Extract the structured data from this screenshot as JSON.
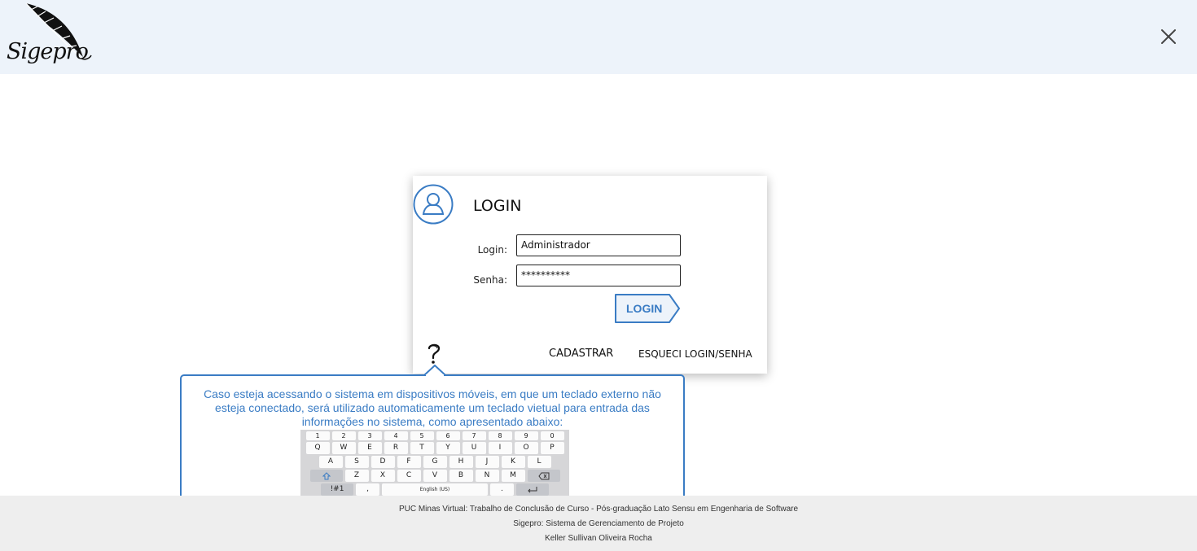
{
  "header": {
    "logo_text": "Sigepro",
    "close_icon": "close-icon"
  },
  "login_card": {
    "title": "LOGIN",
    "avatar_icon": "user-icon",
    "login_label": "Login:",
    "login_value": "Administrador",
    "password_label": "Senha:",
    "password_value": "**********",
    "login_button": "LOGIN",
    "help_icon": "question-mark-icon",
    "register_link": "CADASTRAR",
    "forgot_link": "ESQUECI LOGIN/SENHA"
  },
  "tooltip": {
    "text": "Caso esteja acessando o sistema em dispositivos móveis, em que um teclado externo não esteja conectado, será utilizado automaticamente um teclado vietual para entrada das informações no sistema, como apresentado abaixo:",
    "keyboard": {
      "row1": [
        "1",
        "2",
        "3",
        "4",
        "5",
        "6",
        "7",
        "8",
        "9",
        "0"
      ],
      "row2": [
        "Q",
        "W",
        "E",
        "R",
        "T",
        "Y",
        "U",
        "I",
        "O",
        "P"
      ],
      "row3": [
        "A",
        "S",
        "D",
        "F",
        "G",
        "H",
        "J",
        "K",
        "L"
      ],
      "row4": [
        "Z",
        "X",
        "C",
        "V",
        "B",
        "N",
        "M"
      ],
      "symbols_key": "!#1",
      "comma_key": ",",
      "space_key": "English (US)",
      "period_key": "."
    }
  },
  "footer": {
    "line1": "PUC Minas Virtual: Trabalho de Conclusão de Curso - Pós-graduação Lato Sensu em Engenharia de Software",
    "line2": "Sigepro: Sistema de Gerenciamento de Projeto",
    "line3": "Keller Sullivan Oliveira Rocha"
  },
  "colors": {
    "header_bg": "#edf3fa",
    "accent_blue": "#3a7cc4",
    "footer_bg": "#eeeeee"
  }
}
